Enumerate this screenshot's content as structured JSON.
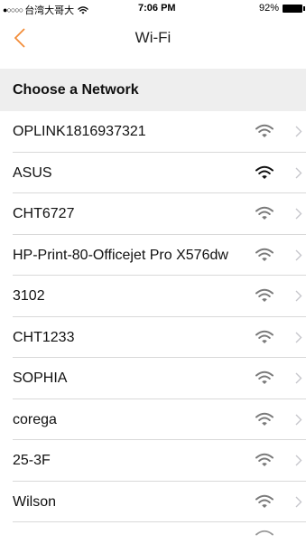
{
  "status_bar": {
    "signal": "●○○○○",
    "carrier": "台湾大哥大",
    "time": "7:06 PM",
    "battery": "92%"
  },
  "nav": {
    "title": "Wi-Fi"
  },
  "section": {
    "header": "Choose a Network"
  },
  "networks": [
    {
      "name": "OPLINK1816937321",
      "icon": "wifi-icon"
    },
    {
      "name": "ASUS",
      "icon": "wifi-icon"
    },
    {
      "name": "CHT6727",
      "icon": "wifi-icon"
    },
    {
      "name": "HP-Print-80-Officejet Pro X576dw",
      "icon": "wifi-icon"
    },
    {
      "name": "3102",
      "icon": "wifi-icon"
    },
    {
      "name": "CHT1233",
      "icon": "wifi-icon"
    },
    {
      "name": "SOPHIA",
      "icon": "wifi-icon"
    },
    {
      "name": "corega",
      "icon": "wifi-icon"
    },
    {
      "name": "25-3F",
      "icon": "wifi-icon"
    },
    {
      "name": "Wilson",
      "icon": "wifi-icon"
    }
  ],
  "colors": {
    "accent": "#f28c38",
    "section_bg": "#eeeeee",
    "separator": "#d9d9d9",
    "chevron": "#c7c7cc"
  }
}
